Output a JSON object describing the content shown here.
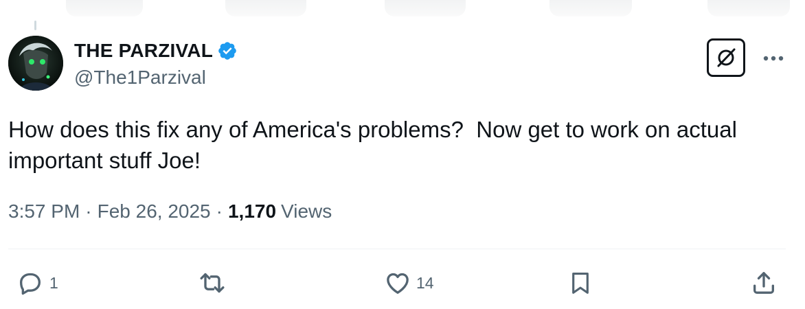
{
  "tweet": {
    "display_name": "THE PARZIVAL",
    "handle": "@The1Parzival",
    "verified": true,
    "text": "How does this fix any of America's problems?  Now get to work on actual important stuff Joe!",
    "time": "3:57 PM",
    "separator": "·",
    "date": "Feb 26, 2025",
    "views_count": "1,170",
    "views_label": "Views"
  },
  "actions": {
    "replies": "1",
    "reposts": "",
    "likes": "14"
  },
  "icons": {
    "verified": "verified-badge-icon",
    "grok": "grok-icon",
    "more": "more-icon",
    "reply": "reply-icon",
    "repost": "repost-icon",
    "like": "like-icon",
    "bookmark": "bookmark-icon",
    "share": "share-icon"
  },
  "colors": {
    "verified_blue": "#1d9bf0",
    "primary_text": "#0f1419",
    "secondary_text": "#536471"
  }
}
